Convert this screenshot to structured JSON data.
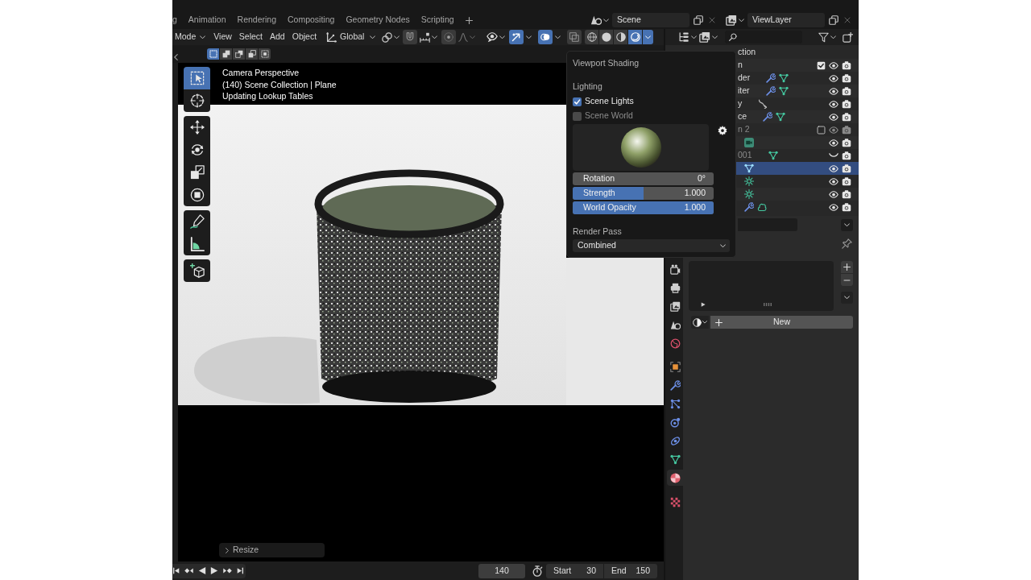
{
  "workspace_tabs": [
    {
      "label": "g",
      "selected": false
    },
    {
      "label": "Animation",
      "selected": false
    },
    {
      "label": "Rendering",
      "selected": false
    },
    {
      "label": "Compositing",
      "selected": false
    },
    {
      "label": "Geometry Nodes",
      "selected": false
    },
    {
      "label": "Scripting",
      "selected": false
    }
  ],
  "scene": {
    "name": "Scene"
  },
  "view_layer": {
    "name": "ViewLayer"
  },
  "viewport_header": {
    "mode": "Mode",
    "menus": [
      "View",
      "Select",
      "Add",
      "Object"
    ],
    "orientation": "Global",
    "toggles": [
      {
        "kind": "snap",
        "on": false
      },
      {
        "kind": "proportional",
        "on": false
      },
      {
        "kind": "gizmos",
        "on": true
      },
      {
        "kind": "overlays",
        "on": true
      },
      {
        "kind": "xray",
        "on": false
      }
    ],
    "shading_modes": [
      {
        "kind": "wireframe",
        "selected": false
      },
      {
        "kind": "solid",
        "selected": false
      },
      {
        "kind": "material",
        "selected": false
      },
      {
        "kind": "rendered",
        "selected": true
      }
    ]
  },
  "select_modes": [
    {
      "kind": "set",
      "selected": true
    },
    {
      "kind": "extend",
      "selected": false
    },
    {
      "kind": "subtract",
      "selected": false
    },
    {
      "kind": "difference",
      "selected": false
    },
    {
      "kind": "intersect",
      "selected": false
    }
  ],
  "toolbar": {
    "groups": [
      {
        "tools": [
          {
            "kind": "select_box",
            "selected": true
          },
          {
            "kind": "cursor",
            "selected": false
          }
        ]
      },
      {
        "tools": [
          {
            "kind": "move",
            "selected": false
          },
          {
            "kind": "rotate",
            "selected": false
          },
          {
            "kind": "scale",
            "selected": false
          },
          {
            "kind": "transform",
            "selected": false
          }
        ]
      },
      {
        "tools": [
          {
            "kind": "annotate",
            "selected": false
          },
          {
            "kind": "measure",
            "selected": false
          }
        ]
      },
      {
        "tools": [
          {
            "kind": "add_cube",
            "selected": false
          }
        ]
      }
    ]
  },
  "viewport_info": [
    "Camera Perspective",
    "(140) Scene Collection | Plane",
    "Updating Lookup Tables"
  ],
  "last_operator": {
    "label": "Resize",
    "expanded": false
  },
  "timeline": {
    "current_frame": "140",
    "start_label": "Start",
    "start": "30",
    "end_label": "End",
    "end": "150"
  },
  "shading_popover": {
    "title": "Viewport Shading",
    "lighting_label": "Lighting",
    "lights": [
      {
        "label": "Scene Lights",
        "checked": true
      },
      {
        "label": "Scene World",
        "checked": false
      }
    ],
    "fields": [
      {
        "kind": "number",
        "label": "Rotation",
        "value": "0°"
      },
      {
        "kind": "slider",
        "label": "Strength",
        "value": "1.000",
        "level": 0.5
      },
      {
        "kind": "slider",
        "label": "World Opacity",
        "value": "1.000",
        "level": 1
      }
    ],
    "render_pass_label": "Render Pass",
    "render_pass": "Combined"
  },
  "outliner": {
    "rows": [
      {
        "kind": "scene_collection",
        "name": "ction",
        "selected": false
      },
      {
        "kind": "collection",
        "name": "n",
        "selected": false,
        "checked": true,
        "visible": true
      },
      {
        "kind": "object",
        "name": "der",
        "icons": [
          {
            "kind": "modifier"
          },
          {
            "kind": "mesh"
          }
        ],
        "selected": false,
        "visible": true
      },
      {
        "kind": "object",
        "name": "iter",
        "icons": [
          {
            "kind": "modifier"
          },
          {
            "kind": "mesh"
          }
        ],
        "selected": false,
        "visible": true
      },
      {
        "kind": "object",
        "name": "y",
        "icons": [
          {
            "kind": "curve"
          }
        ],
        "selected": false,
        "visible": true
      },
      {
        "kind": "object",
        "name": "ce",
        "icons": [
          {
            "kind": "modifier"
          },
          {
            "kind": "mesh"
          }
        ],
        "selected": false,
        "visible": true
      },
      {
        "kind": "collection",
        "name": "n 2",
        "selected": false,
        "checked": false,
        "visible": true
      },
      {
        "kind": "object",
        "icons": [
          {
            "kind": "camera_data"
          }
        ],
        "selected": false,
        "visible": true
      },
      {
        "kind": "object",
        "name": "001",
        "icons": [
          {
            "kind": "mesh"
          }
        ],
        "selected": false,
        "visible": false
      },
      {
        "kind": "object",
        "icons": [
          {
            "kind": "mesh"
          }
        ],
        "selected": true,
        "visible": true
      },
      {
        "kind": "object",
        "icons": [
          {
            "kind": "light"
          }
        ],
        "selected": false,
        "visible": true
      },
      {
        "kind": "object",
        "icons": [
          {
            "kind": "light"
          }
        ],
        "selected": false,
        "visible": true
      },
      {
        "kind": "object",
        "icons": [
          {
            "kind": "modifier"
          },
          {
            "kind": "metaball"
          }
        ],
        "selected": false,
        "visible": true
      }
    ]
  },
  "properties": {
    "tabs": [
      {
        "kind": "render",
        "selected": false
      },
      {
        "kind": "output",
        "selected": false
      },
      {
        "kind": "view_layer",
        "selected": false
      },
      {
        "kind": "scene",
        "selected": false
      },
      {
        "kind": "world",
        "selected": false
      },
      {
        "kind": "object",
        "selected": false
      },
      {
        "kind": "modifiers",
        "selected": false
      },
      {
        "kind": "particles",
        "selected": false
      },
      {
        "kind": "physics",
        "selected": false
      },
      {
        "kind": "constraints",
        "selected": false
      },
      {
        "kind": "data",
        "selected": false
      },
      {
        "kind": "material",
        "selected": true
      },
      {
        "kind": "texture",
        "selected": false
      }
    ],
    "new_button": "New"
  }
}
